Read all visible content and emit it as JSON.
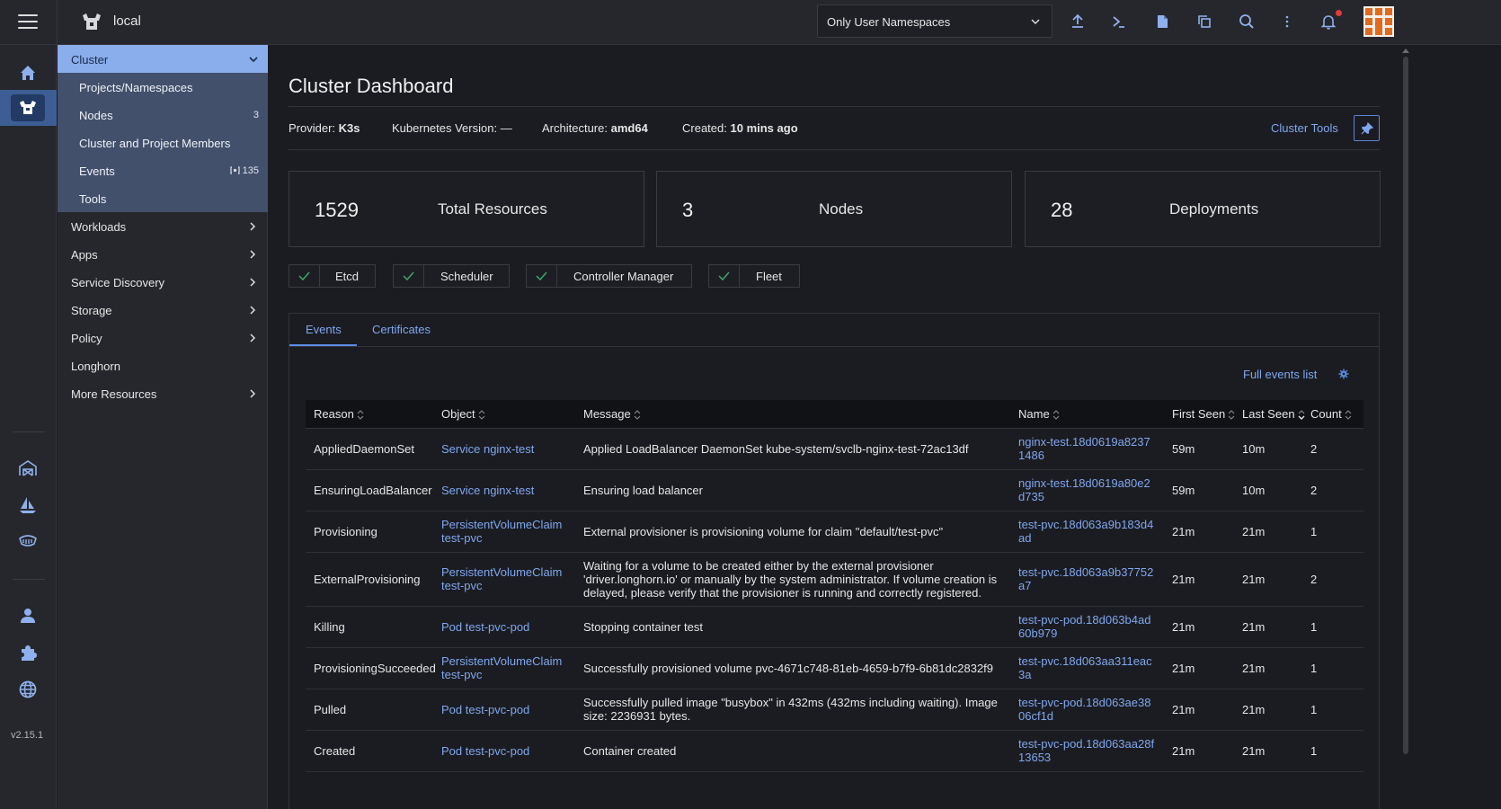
{
  "header": {
    "cluster_name": "local",
    "namespace_filter": "Only User Namespaces"
  },
  "rail": {
    "version": "v2.15.1"
  },
  "sidenav": {
    "group": "Cluster",
    "sub_items": [
      {
        "label": "Projects/Namespaces",
        "count": ""
      },
      {
        "label": "Nodes",
        "count": "3"
      },
      {
        "label": "Cluster and Project Members",
        "count": ""
      },
      {
        "label": "Events",
        "count": "135"
      },
      {
        "label": "Tools",
        "count": ""
      }
    ],
    "items": [
      {
        "label": "Workloads",
        "expandable": true
      },
      {
        "label": "Apps",
        "expandable": true
      },
      {
        "label": "Service Discovery",
        "expandable": true
      },
      {
        "label": "Storage",
        "expandable": true
      },
      {
        "label": "Policy",
        "expandable": true
      },
      {
        "label": "Longhorn",
        "expandable": false
      },
      {
        "label": "More Resources",
        "expandable": true
      }
    ]
  },
  "main": {
    "title": "Cluster Dashboard",
    "meta": {
      "provider_label": "Provider:",
      "provider": "K3s",
      "k8s_label": "Kubernetes Version:",
      "k8s": "—",
      "arch_label": "Architecture:",
      "arch": "amd64",
      "created_label": "Created:",
      "created": "10 mins ago"
    },
    "cluster_tools": "Cluster Tools",
    "cards": [
      {
        "number": "1529",
        "label": "Total Resources"
      },
      {
        "number": "3",
        "label": "Nodes"
      },
      {
        "number": "28",
        "label": "Deployments"
      }
    ],
    "health": [
      "Etcd",
      "Scheduler",
      "Controller Manager",
      "Fleet"
    ],
    "tabs": [
      "Events",
      "Certificates"
    ],
    "full_events": "Full events list",
    "columns": [
      "Reason",
      "Object",
      "Message",
      "Name",
      "First Seen",
      "Last Seen",
      "Count"
    ],
    "rows": [
      {
        "reason": "AppliedDaemonSet",
        "object": "Service nginx-test",
        "message": "Applied LoadBalancer DaemonSet kube-system/svclb-nginx-test-72ac13df",
        "name": "nginx-test.18d0619a82371486",
        "first": "59m",
        "last": "10m",
        "count": "2"
      },
      {
        "reason": "EnsuringLoadBalancer",
        "object": "Service nginx-test",
        "message": "Ensuring load balancer",
        "name": "nginx-test.18d0619a80e2d735",
        "first": "59m",
        "last": "10m",
        "count": "2"
      },
      {
        "reason": "Provisioning",
        "object": "PersistentVolumeClaim test-pvc",
        "message": "External provisioner is provisioning volume for claim \"default/test-pvc\"",
        "name": "test-pvc.18d063a9b183d4ad",
        "first": "21m",
        "last": "21m",
        "count": "1"
      },
      {
        "reason": "ExternalProvisioning",
        "object": "PersistentVolumeClaim test-pvc",
        "message": "Waiting for a volume to be created either by the external provisioner 'driver.longhorn.io' or manually by the system administrator. If volume creation is delayed, please verify that the provisioner is running and correctly registered.",
        "name": "test-pvc.18d063a9b37752a7",
        "first": "21m",
        "last": "21m",
        "count": "2"
      },
      {
        "reason": "Killing",
        "object": "Pod test-pvc-pod",
        "message": "Stopping container test",
        "name": "test-pvc-pod.18d063b4ad60b979",
        "first": "21m",
        "last": "21m",
        "count": "1"
      },
      {
        "reason": "ProvisioningSucceeded",
        "object": "PersistentVolumeClaim test-pvc",
        "message": "Successfully provisioned volume pvc-4671c748-81eb-4659-b7f9-6b81dc2832f9",
        "name": "test-pvc.18d063aa311eac3a",
        "first": "21m",
        "last": "21m",
        "count": "1"
      },
      {
        "reason": "Pulled",
        "object": "Pod test-pvc-pod",
        "message": "Successfully pulled image \"busybox\" in 432ms (432ms including waiting). Image size: 2236931 bytes.",
        "name": "test-pvc-pod.18d063ae3806cf1d",
        "first": "21m",
        "last": "21m",
        "count": "1"
      },
      {
        "reason": "Created",
        "object": "Pod test-pvc-pod",
        "message": "Container created",
        "name": "test-pvc-pod.18d063aa28f13653",
        "first": "21m",
        "last": "21m",
        "count": "1"
      }
    ]
  },
  "colors": {
    "accent": "#7fa7ef",
    "nav_active": "#8aadeb",
    "nav_sub_bg": "#43506c",
    "notification": "#e23b3b",
    "check": "#3fa66b"
  }
}
